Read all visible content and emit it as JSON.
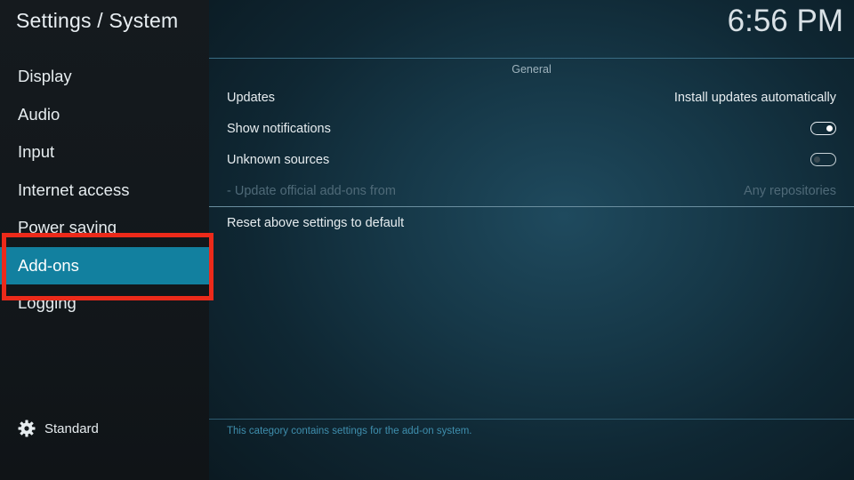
{
  "header": {
    "title": "Settings / System",
    "clock": "6:56 PM"
  },
  "sidebar": {
    "items": [
      {
        "label": "Display"
      },
      {
        "label": "Audio"
      },
      {
        "label": "Input"
      },
      {
        "label": "Internet access"
      },
      {
        "label": "Power saving"
      },
      {
        "label": "Add-ons",
        "active": true
      },
      {
        "label": "Logging"
      }
    ],
    "level_label": "Standard",
    "level_icon": "gear-icon"
  },
  "main": {
    "section_title": "General",
    "settings": [
      {
        "label": "Updates",
        "value": "Install updates automatically"
      },
      {
        "label": "Show notifications",
        "toggle": true
      },
      {
        "label": "Unknown sources",
        "toggle": false
      },
      {
        "label": "- Update official add-ons from",
        "value": "Any repositories",
        "disabled": true
      }
    ],
    "reset_label": "Reset above settings to default",
    "help_text": "This category contains settings for the add-on system."
  },
  "colors": {
    "active_item": "#12809f",
    "highlight_box": "#ec2a1a",
    "help_text": "#3f8fae"
  }
}
